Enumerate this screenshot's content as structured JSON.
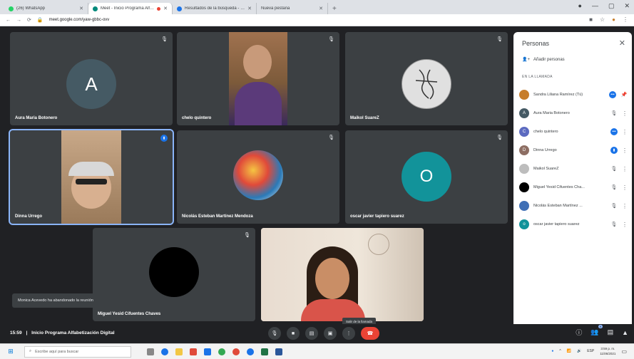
{
  "browser": {
    "tabs": [
      {
        "label": "(26) WhatsApp",
        "color": "#25d366",
        "active": false
      },
      {
        "label": "Meet - Inicio Programa Alfabetización Digital",
        "color": "#00897b",
        "active": true
      },
      {
        "label": "Resultados de la búsqueda - Google",
        "color": "#1a73e8",
        "active": false
      },
      {
        "label": "Nueva pestaña",
        "color": "#9aa0a6",
        "active": false
      }
    ],
    "new_tab": "+",
    "url": "meet.google.com/yaw-gbbc-ovv"
  },
  "tiles": [
    {
      "name": "Aura Maria Botonero",
      "initial": "A",
      "avatar_color": "#455a64"
    },
    {
      "name": "chelo quintero"
    },
    {
      "name": "Maikol SuareZ"
    },
    {
      "name": "Dinna Urrego"
    },
    {
      "name": "Nicolás Esteban Martínez Mendoza"
    },
    {
      "name": "oscar javier tapiero suarez",
      "initial": "O",
      "avatar_color": "#12939a"
    },
    {
      "name": "Miguel Yesid Cifuentes Chaves"
    },
    {
      "name": ""
    }
  ],
  "panel": {
    "title": "Personas",
    "add_people": "Añadir personas",
    "section": "EN LA LLAMADA",
    "people": [
      {
        "name": "Sandra Liliana Ramírez (Tú)",
        "initial": "S",
        "color": "#c77d2a",
        "state": "speaking"
      },
      {
        "name": "Aura Maria Botonero",
        "initial": "A",
        "color": "#455a64",
        "state": "muted"
      },
      {
        "name": "chelo quintero",
        "initial": "C",
        "color": "#5c6bc0",
        "state": "speaking"
      },
      {
        "name": "Dinna Urrego",
        "initial": "D",
        "color": "#8d6e63",
        "state": "speaking"
      },
      {
        "name": "Maikol SuareZ",
        "initial": "M",
        "color": "#bdbdbd",
        "state": "muted"
      },
      {
        "name": "Miguel Yesid Cifuentes Cha...",
        "initial": "",
        "color": "#000000",
        "state": "muted"
      },
      {
        "name": "Nicolás Esteban Martínez ...",
        "initial": "N",
        "color": "#3f6fb5",
        "state": "muted"
      },
      {
        "name": "oscar javier tapiero suarez",
        "initial": "o",
        "color": "#12939a",
        "state": "muted"
      }
    ]
  },
  "toast": "Monica Acevedo ha abandonado la reunión",
  "tooltip": "Salir de la llamada",
  "bottom_bar": {
    "time": "15:59",
    "separator": "|",
    "meeting_title": "Inicio Programa Alfabetización Digital",
    "participant_count": "9"
  },
  "taskbar": {
    "search_placeholder": "Escribe aquí para buscar",
    "time": "3:59 p. m.",
    "date": "11/06/2021",
    "lang": "ESP"
  }
}
